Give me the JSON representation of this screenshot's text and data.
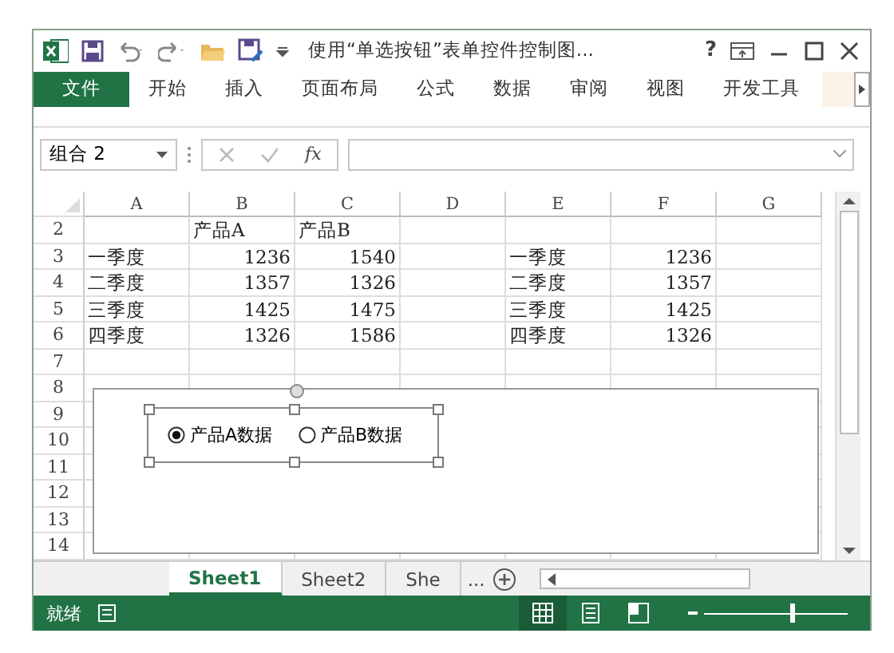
{
  "title_bar": {
    "title": "使用“单选按钮”表单控件控制图...",
    "help": "?"
  },
  "ribbon_tabs": [
    {
      "label": "文件",
      "selected": true
    },
    {
      "label": "开始",
      "selected": false
    },
    {
      "label": "插入",
      "selected": false
    },
    {
      "label": "页面布局",
      "selected": false
    },
    {
      "label": "公式",
      "selected": false
    },
    {
      "label": "数据",
      "selected": false
    },
    {
      "label": "审阅",
      "selected": false
    },
    {
      "label": "视图",
      "selected": false
    },
    {
      "label": "开发工具",
      "selected": false
    }
  ],
  "formula_bar": {
    "name_box": "组合 2",
    "fx": "fx"
  },
  "columns": [
    "A",
    "B",
    "C",
    "D",
    "E",
    "F",
    "G"
  ],
  "rows": [
    {
      "number": "2",
      "cells": {
        "B": {
          "text": "产品A",
          "kind": "text"
        },
        "C": {
          "text": "产品B",
          "kind": "text"
        }
      }
    },
    {
      "number": "3",
      "cells": {
        "A": {
          "text": "一季度",
          "kind": "text"
        },
        "B": {
          "text": "1236",
          "kind": "number"
        },
        "C": {
          "text": "1540",
          "kind": "number"
        },
        "E": {
          "text": "一季度",
          "kind": "text"
        },
        "F": {
          "text": "1236",
          "kind": "number"
        }
      }
    },
    {
      "number": "4",
      "cells": {
        "A": {
          "text": "二季度",
          "kind": "text"
        },
        "B": {
          "text": "1357",
          "kind": "number"
        },
        "C": {
          "text": "1326",
          "kind": "number"
        },
        "E": {
          "text": "二季度",
          "kind": "text"
        },
        "F": {
          "text": "1357",
          "kind": "number"
        }
      }
    },
    {
      "number": "5",
      "cells": {
        "A": {
          "text": "三季度",
          "kind": "text"
        },
        "B": {
          "text": "1425",
          "kind": "number"
        },
        "C": {
          "text": "1475",
          "kind": "number"
        },
        "E": {
          "text": "三季度",
          "kind": "text"
        },
        "F": {
          "text": "1425",
          "kind": "number"
        }
      }
    },
    {
      "number": "6",
      "cells": {
        "A": {
          "text": "四季度",
          "kind": "text"
        },
        "B": {
          "text": "1326",
          "kind": "number"
        },
        "C": {
          "text": "1586",
          "kind": "number"
        },
        "E": {
          "text": "四季度",
          "kind": "text"
        },
        "F": {
          "text": "1326",
          "kind": "number"
        }
      }
    },
    {
      "number": "7"
    },
    {
      "number": "8"
    },
    {
      "number": "9"
    },
    {
      "number": "10"
    },
    {
      "number": "11"
    },
    {
      "number": "12"
    },
    {
      "number": "13"
    },
    {
      "number": "14"
    }
  ],
  "form_control": {
    "options": [
      {
        "label": "产品A数据",
        "selected": true
      },
      {
        "label": "产品B数据",
        "selected": false
      }
    ]
  },
  "sheet_tabs": [
    {
      "label": "Sheet1",
      "selected": true
    },
    {
      "label": "Sheet2",
      "selected": false
    },
    {
      "label": "She",
      "selected": false
    }
  ],
  "more_sheets": "...",
  "status_bar": {
    "text": "就绪",
    "views": [
      {
        "kind": "normal",
        "selected": true
      },
      {
        "kind": "layout",
        "selected": false
      },
      {
        "kind": "pagebreak",
        "selected": false
      }
    ],
    "zoom": {
      "level": 0.6
    }
  }
}
